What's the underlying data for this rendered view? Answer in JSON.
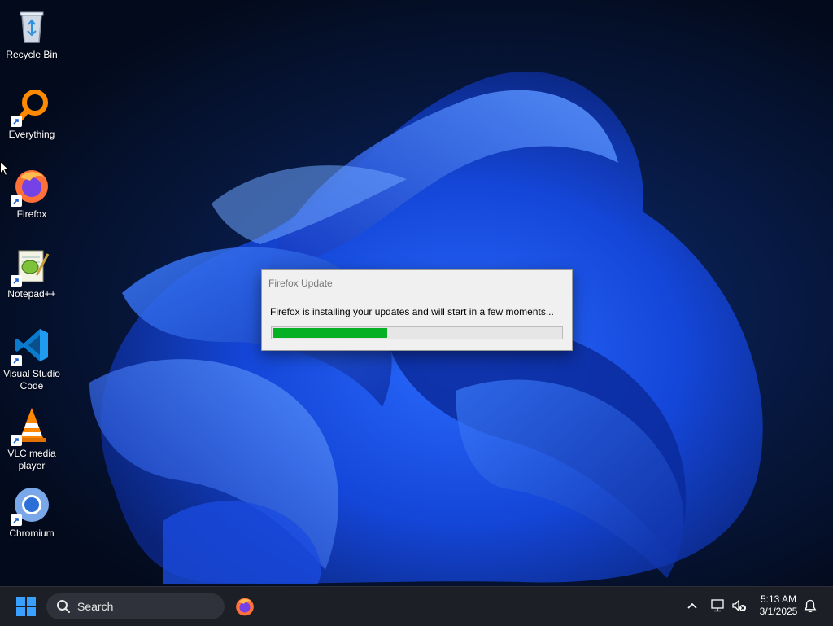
{
  "desktop": {
    "icons": [
      {
        "label": "Recycle Bin",
        "icon": "recycle-bin-icon"
      },
      {
        "label": "Everything",
        "icon": "everything-search-icon"
      },
      {
        "label": "Firefox",
        "icon": "firefox-icon"
      },
      {
        "label": "Notepad++",
        "icon": "notepad-plus-plus-icon"
      },
      {
        "label": "Visual Studio Code",
        "icon": "vscode-icon"
      },
      {
        "label": "VLC media player",
        "icon": "vlc-icon"
      },
      {
        "label": "Chromium",
        "icon": "chromium-icon"
      }
    ]
  },
  "dialog": {
    "title": "Firefox Update",
    "message": "Firefox is installing your updates and will start in a few moments...",
    "progress_fraction": 0.4
  },
  "taskbar": {
    "search_label": "Search",
    "time": "5:13 AM",
    "date": "3/1/2025",
    "pinned": [
      "firefox-icon"
    ],
    "tray_icons": [
      "chevron-up-icon",
      "network-icon",
      "volume-muted-icon",
      "notification-bell-icon"
    ]
  },
  "colors": {
    "progress_green": "#06b025",
    "taskbar_bg": "#1c1f26",
    "accent_blue": "#1f5cff"
  }
}
